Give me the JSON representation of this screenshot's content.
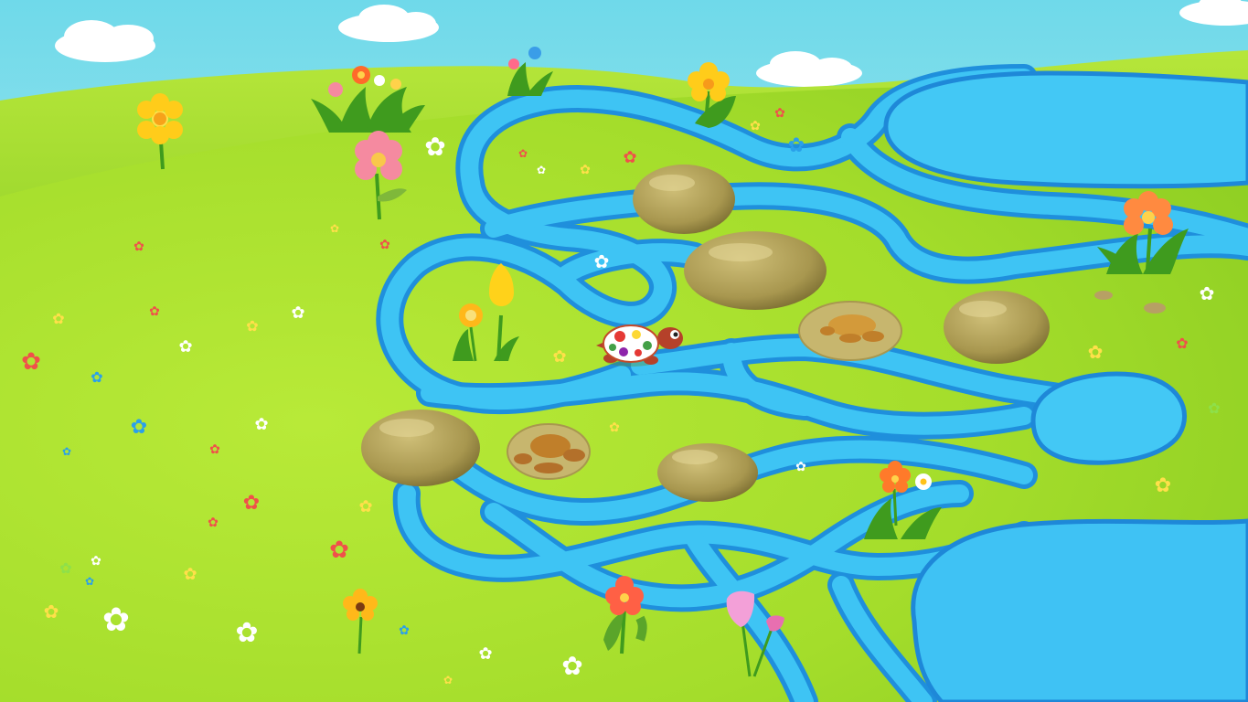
{
  "game": {
    "scene": "river-maze",
    "player": {
      "character": "turtle",
      "shell_colors": [
        "#ffffff",
        "#e53935",
        "#fdd835",
        "#43a047",
        "#8e24aa"
      ]
    },
    "stones": [
      {
        "kind": "rock"
      },
      {
        "kind": "rock"
      },
      {
        "kind": "turtle-stone"
      },
      {
        "kind": "rock"
      },
      {
        "kind": "rock"
      },
      {
        "kind": "turtle-stone"
      },
      {
        "kind": "rock"
      }
    ],
    "colors": {
      "sky_top": "#7fe0ee",
      "sky_bottom": "#c9f3f2",
      "grass_light": "#c8ef3c",
      "grass_mid": "#a5df2a",
      "grass_dark": "#86c91c",
      "water": "#3ec4f4",
      "water_edge": "#1e88d8",
      "rock": "#b4a460",
      "rock_shadow": "#7f7236",
      "turtle_stone": "#c98a3e"
    },
    "icons": [
      "cloud-icon",
      "flower-icon",
      "tulip-icon",
      "daisy-icon",
      "grass-tuft-icon",
      "pebble-icon"
    ]
  }
}
